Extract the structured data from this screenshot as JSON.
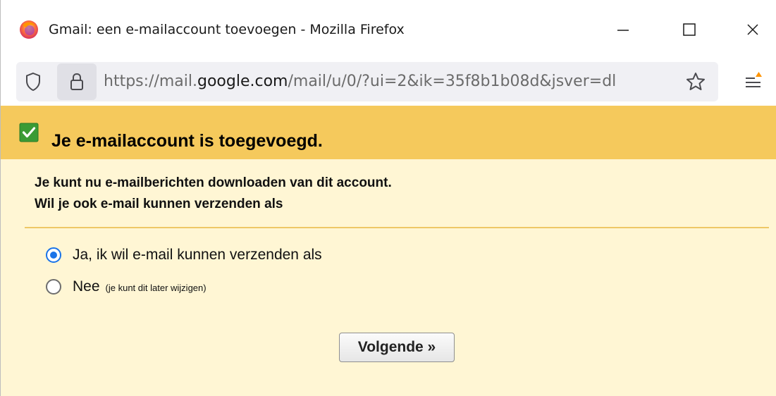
{
  "window": {
    "title": "Gmail: een e-mailaccount toevoegen - Mozilla Firefox",
    "icons": {
      "app": "firefox-logo",
      "minimize": "minimize-icon",
      "maximize": "maximize-icon",
      "close": "close-icon"
    }
  },
  "addressbar": {
    "url_prefix": "https://mail.",
    "url_host": "google.com",
    "url_suffix": "/mail/u/0/?ui=2&ik=35f8b1b08d&jsver=dl",
    "icons": {
      "tracking": "shield-icon",
      "security": "lock-icon",
      "bookmark": "star-icon",
      "menu": "menu-icon"
    }
  },
  "banner": {
    "title": "Je e-mailaccount is toegevoegd.",
    "icon": "check-icon",
    "color": "#f5c95c"
  },
  "description": {
    "line1": "Je kunt nu e-mailberichten downloaden van dit account.",
    "line2": "Wil je ook e-mail kunnen verzenden als"
  },
  "options": [
    {
      "label": "Ja, ik wil e-mail kunnen verzenden als",
      "note": "",
      "selected": true
    },
    {
      "label": "Nee",
      "note": "(je kunt dit later wijzigen)",
      "selected": false
    }
  ],
  "next_button": {
    "label": "Volgende »"
  },
  "colors": {
    "content_background": "#fff6d4",
    "divider": "#eec866",
    "radio_selected": "#1a73e8"
  }
}
